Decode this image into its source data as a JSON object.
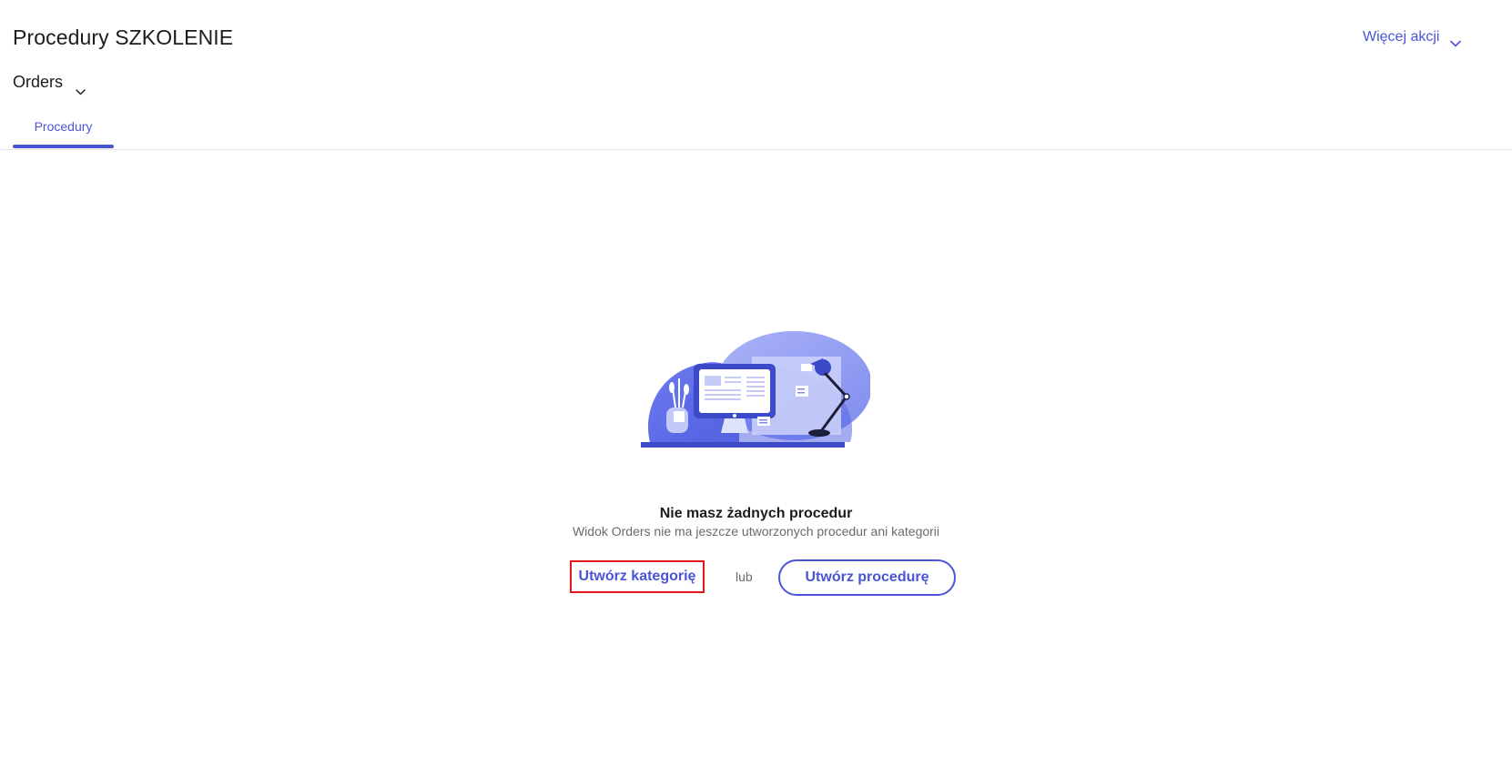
{
  "header": {
    "title": "Procedury SZKOLENIE",
    "more_actions_label": "Więcej akcji",
    "view_selector_label": "Orders"
  },
  "tabs": [
    {
      "label": "Procedury",
      "active": true
    }
  ],
  "empty_state": {
    "title": "Nie masz żadnych procedur",
    "subtitle": "Widok Orders nie ma jeszcze utworzonych procedur ani kategorii",
    "create_category_label": "Utwórz kategorię",
    "or_label": "lub",
    "create_procedure_label": "Utwórz procedurę",
    "illustration": "desk-with-monitor-and-lamp-illustration"
  },
  "icons": {
    "more_actions": "chevron-down-icon",
    "view_selector": "chevron-down-icon"
  },
  "colors": {
    "accent": "#4a55d6",
    "highlight_border": "#e3161b",
    "text_primary": "#1c1c1c",
    "text_secondary": "#6a6a6a"
  }
}
